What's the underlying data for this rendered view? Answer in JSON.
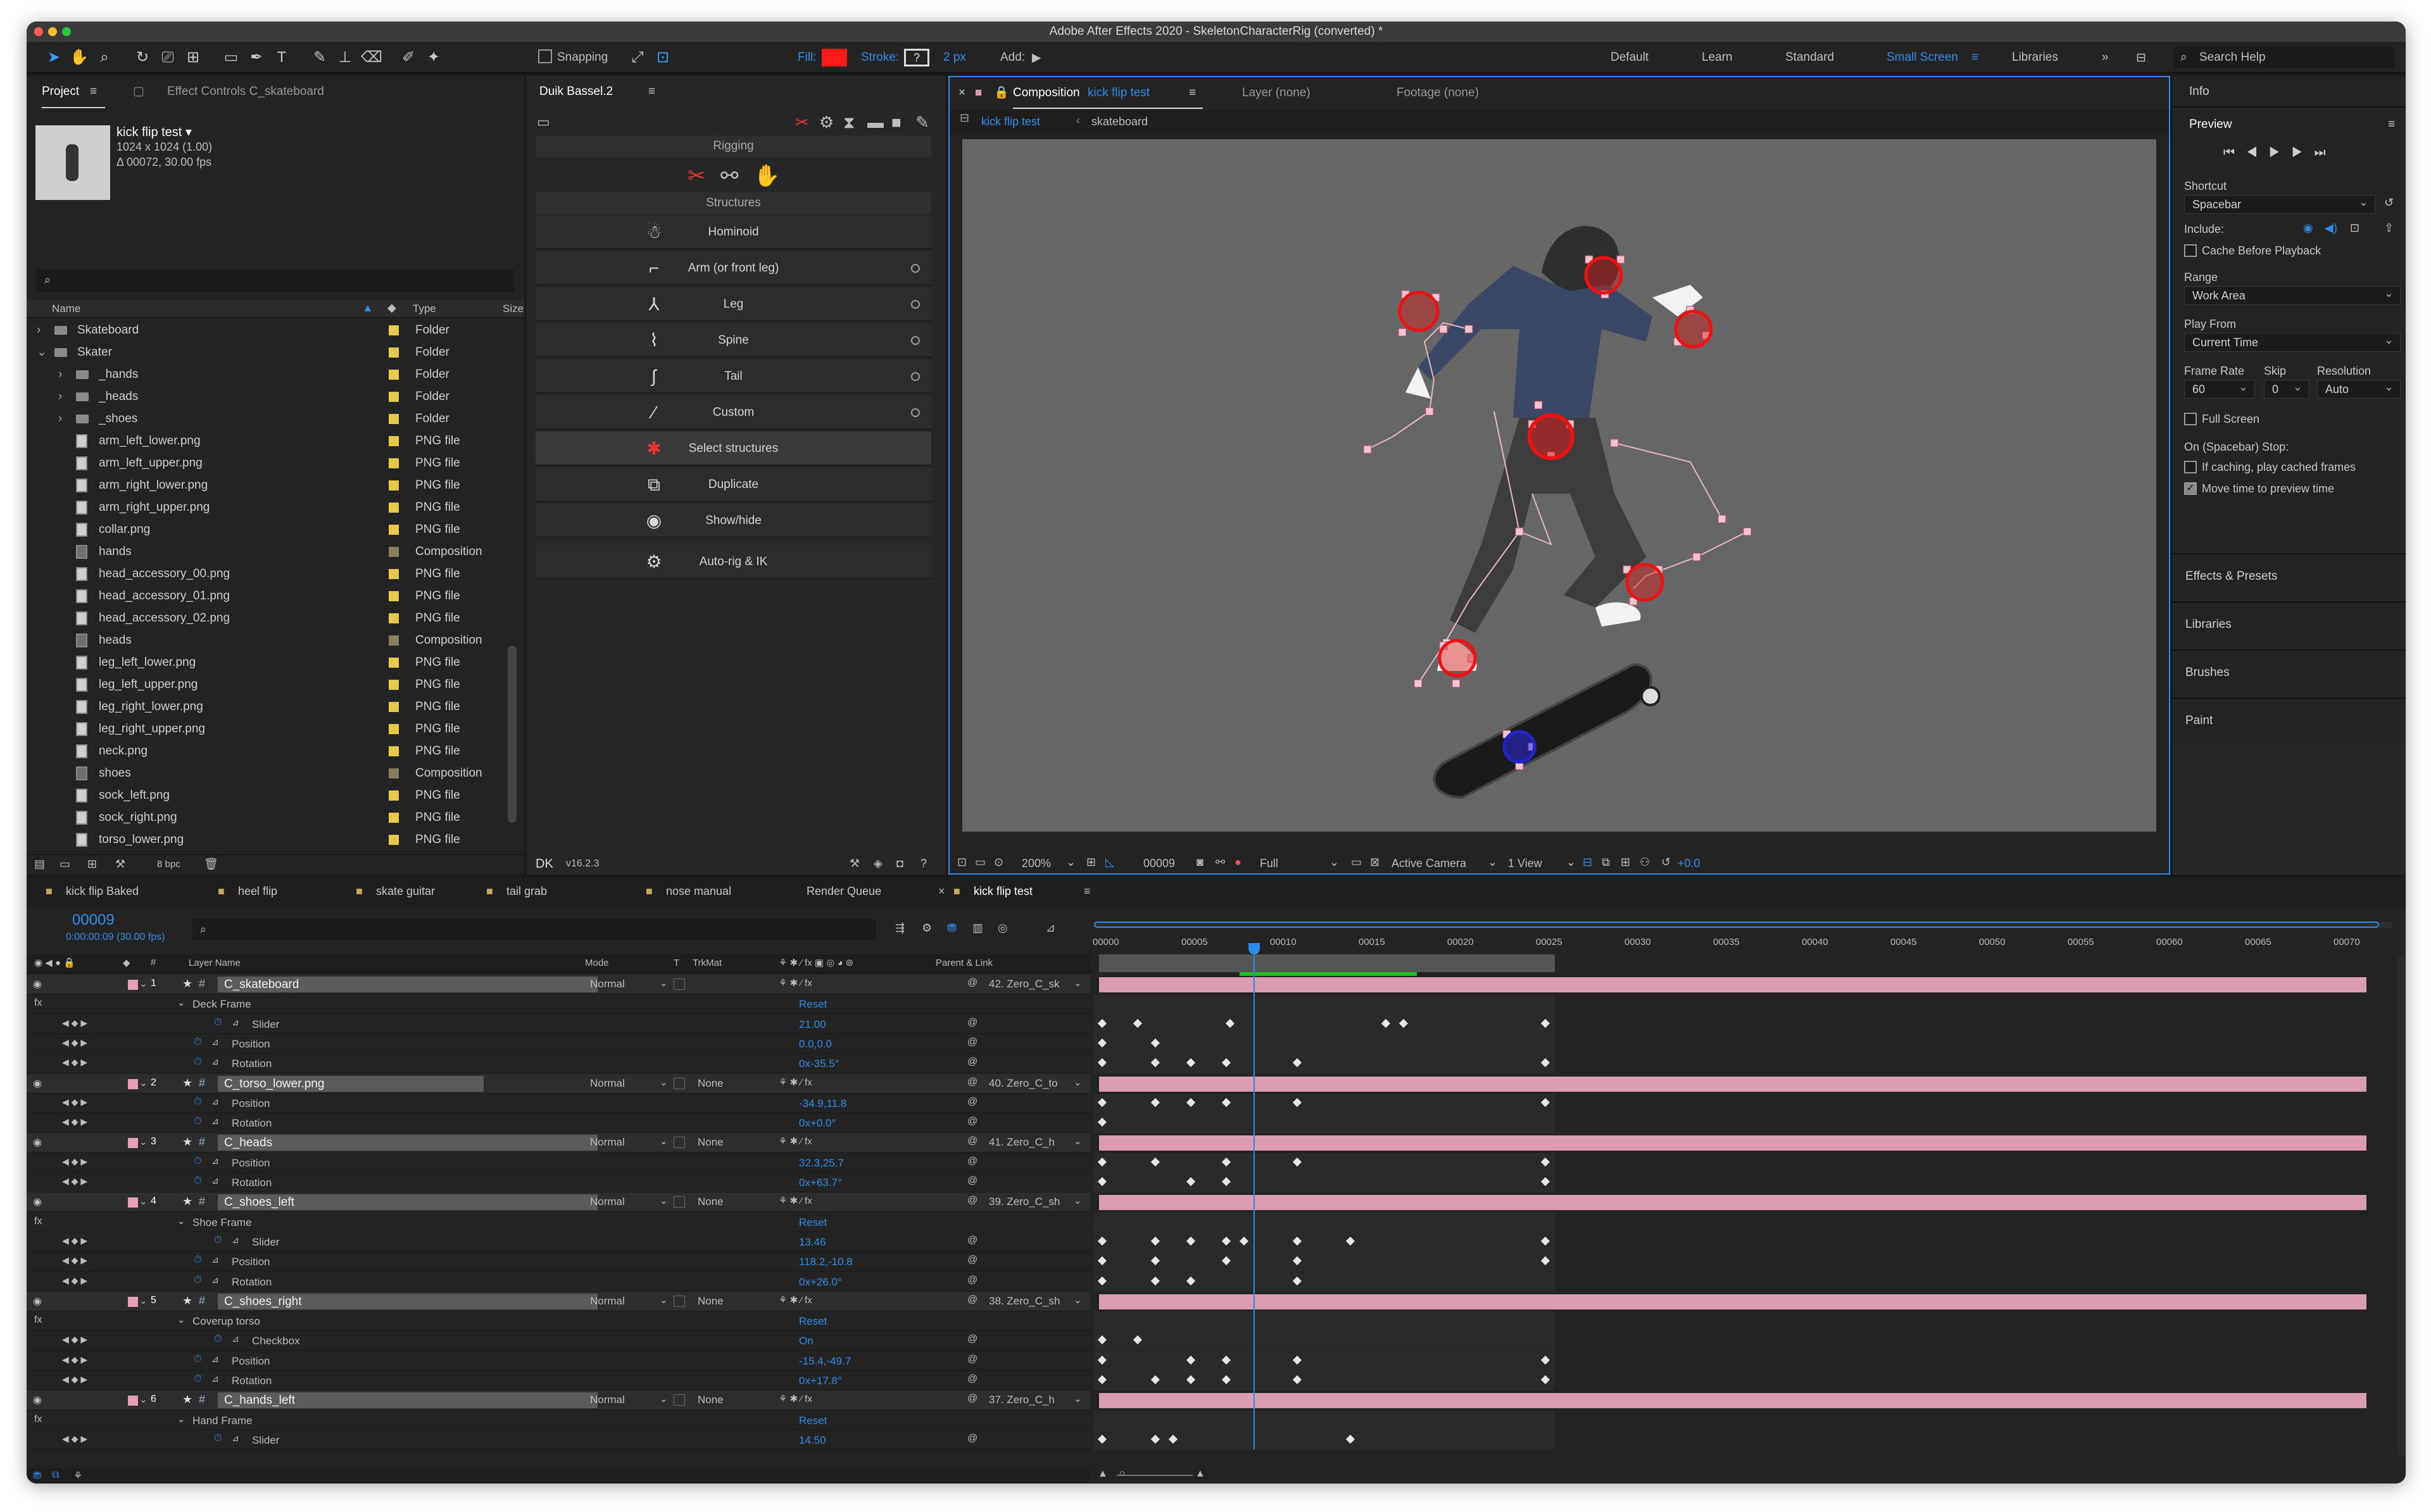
{
  "window": {
    "title": "Adobe After Effects 2020 - SkeletonCharacterRig (converted) *"
  },
  "toolbar": {
    "snapping": "Snapping",
    "fill": "Fill:",
    "stroke": "Stroke:",
    "stroke_width": "2 px",
    "add": "Add:",
    "workspaces": [
      "Default",
      "Learn",
      "Standard",
      "Small Screen",
      "Libraries"
    ],
    "active_workspace": "Small Screen",
    "search_help": "Search Help",
    "fill_color": "#ff1a1a"
  },
  "project": {
    "tab": "Project",
    "effect_tab": "Effect Controls C_skateboard",
    "item_name": "kick flip test ▾",
    "item_size": "1024 x 1024 (1.00)",
    "item_duration": "Δ 00072, 30.00 fps",
    "col_name": "Name",
    "col_type": "Type",
    "col_size": "Size",
    "bpc": "8 bpc",
    "items": [
      {
        "name": "Skateboard",
        "type": "Folder",
        "kind": "folder",
        "indent": 0,
        "twirl": "›"
      },
      {
        "name": "Skater",
        "type": "Folder",
        "kind": "folder",
        "indent": 0,
        "twirl": "⌄"
      },
      {
        "name": "_hands",
        "type": "Folder",
        "kind": "folder",
        "indent": 1,
        "twirl": "›"
      },
      {
        "name": "_heads",
        "type": "Folder",
        "kind": "folder",
        "indent": 1,
        "twirl": "›"
      },
      {
        "name": "_shoes",
        "type": "Folder",
        "kind": "folder",
        "indent": 1,
        "twirl": "›"
      },
      {
        "name": "arm_left_lower.png",
        "type": "PNG file",
        "kind": "file",
        "indent": 1
      },
      {
        "name": "arm_left_upper.png",
        "type": "PNG file",
        "kind": "file",
        "indent": 1
      },
      {
        "name": "arm_right_lower.png",
        "type": "PNG file",
        "kind": "file",
        "indent": 1
      },
      {
        "name": "arm_right_upper.png",
        "type": "PNG file",
        "kind": "file",
        "indent": 1
      },
      {
        "name": "collar.png",
        "type": "PNG file",
        "kind": "file",
        "indent": 1
      },
      {
        "name": "hands",
        "type": "Composition",
        "kind": "comp",
        "indent": 1
      },
      {
        "name": "head_accessory_00.png",
        "type": "PNG file",
        "kind": "file",
        "indent": 1
      },
      {
        "name": "head_accessory_01.png",
        "type": "PNG file",
        "kind": "file",
        "indent": 1
      },
      {
        "name": "head_accessory_02.png",
        "type": "PNG file",
        "kind": "file",
        "indent": 1
      },
      {
        "name": "heads",
        "type": "Composition",
        "kind": "comp",
        "indent": 1
      },
      {
        "name": "leg_left_lower.png",
        "type": "PNG file",
        "kind": "file",
        "indent": 1
      },
      {
        "name": "leg_left_upper.png",
        "type": "PNG file",
        "kind": "file",
        "indent": 1
      },
      {
        "name": "leg_right_lower.png",
        "type": "PNG file",
        "kind": "file",
        "indent": 1
      },
      {
        "name": "leg_right_upper.png",
        "type": "PNG file",
        "kind": "file",
        "indent": 1
      },
      {
        "name": "neck.png",
        "type": "PNG file",
        "kind": "file",
        "indent": 1
      },
      {
        "name": "shoes",
        "type": "Composition",
        "kind": "comp",
        "indent": 1
      },
      {
        "name": "sock_left.png",
        "type": "PNG file",
        "kind": "file",
        "indent": 1
      },
      {
        "name": "sock_right.png",
        "type": "PNG file",
        "kind": "file",
        "indent": 1
      },
      {
        "name": "torso_lower.png",
        "type": "PNG file",
        "kind": "file",
        "indent": 1
      },
      {
        "name": "torso_upper.png",
        "type": "PNG file",
        "kind": "file",
        "indent": 1
      }
    ]
  },
  "duik": {
    "tab": "Duik Bassel.2",
    "rigging": "Rigging",
    "structures": "Structures",
    "version": "v16.2.3",
    "rows": [
      {
        "label": "Hominoid",
        "icon": "☃",
        "dot": false
      },
      {
        "label": "Arm (or front leg)",
        "icon": "⌐",
        "dot": true
      },
      {
        "label": "Leg",
        "icon": "⅄",
        "dot": true
      },
      {
        "label": "Spine",
        "icon": "⌇",
        "dot": true
      },
      {
        "label": "Tail",
        "icon": "∫",
        "dot": true
      },
      {
        "label": "Custom",
        "icon": "⁄",
        "dot": true
      },
      {
        "label": "Select structures",
        "icon": "✱",
        "dot": false
      },
      {
        "label": "Duplicate",
        "icon": "⧉",
        "dot": false
      },
      {
        "label": "Show/hide",
        "icon": "◉",
        "dot": false
      },
      {
        "label": "Auto-rig & IK",
        "icon": "⚙",
        "dot": false
      }
    ]
  },
  "composition": {
    "tab_prefix": "Composition",
    "tab_name": "kick flip test",
    "layer_tab": "Layer (none)",
    "footage_tab": "Footage (none)",
    "crumb_active": "kick flip test",
    "crumb_next": "skateboard",
    "zoom": "200%",
    "frame": "00009",
    "resolution": "Full",
    "camera": "Active Camera",
    "views": "1 View",
    "exposure": "+0.0"
  },
  "right_panel": {
    "info": "Info",
    "preview": "Preview",
    "shortcut_label": "Shortcut",
    "shortcut": "Spacebar",
    "include": "Include:",
    "cache_before": "Cache Before Playback",
    "range_label": "Range",
    "range": "Work Area",
    "play_from_label": "Play From",
    "play_from": "Current Time",
    "frame_rate_label": "Frame Rate",
    "skip_label": "Skip",
    "resolution_label": "Resolution",
    "frame_rate": "60",
    "skip": "0",
    "resolution": "Auto",
    "full_screen": "Full Screen",
    "on_stop": "On (Spacebar) Stop:",
    "if_caching": "If caching, play cached frames",
    "move_time": "Move time to preview time",
    "sections": [
      "Effects & Presets",
      "Libraries",
      "Brushes",
      "Paint"
    ]
  },
  "timeline": {
    "tabs": [
      "kick flip Baked",
      "heel flip",
      "skate guitar",
      "tail grab",
      "nose manual",
      "Render Queue",
      "kick flip test"
    ],
    "active_tab": "kick flip test",
    "timecode": "00009",
    "timecode_sub": "0:00:00:09 (30.00 fps)",
    "col_layer_name": "Layer Name",
    "col_mode": "Mode",
    "col_t": "T",
    "col_trkmat": "TrkMat",
    "col_parent": "Parent & Link",
    "ruler": [
      "00000",
      "00005",
      "00010",
      "00015",
      "00020",
      "00025",
      "00030",
      "00035",
      "00040",
      "00045",
      "00050",
      "00055",
      "00060",
      "00065",
      "00070"
    ],
    "rows": [
      {
        "kind": "layer",
        "num": "1",
        "name": "C_skateboard",
        "mode": "Normal",
        "trkmat": "",
        "parent": "42. Zero_C_sk",
        "kfs": []
      },
      {
        "kind": "fx",
        "label": "Deck Frame",
        "value": "Reset",
        "kfs": []
      },
      {
        "kind": "prop",
        "label": "Slider",
        "value": "21.00",
        "indent": 2,
        "kfs": [
          0,
          1,
          3.6,
          8,
          8.5,
          12.5
        ]
      },
      {
        "kind": "prop",
        "label": "Position",
        "value": "0.0,0.0",
        "indent": 1,
        "kfs": [
          0,
          1.5
        ]
      },
      {
        "kind": "prop",
        "label": "Rotation",
        "value": "0x-35.5°",
        "indent": 1,
        "kfs": [
          0,
          1.5,
          2.5,
          3.5,
          5.5,
          12.5
        ]
      },
      {
        "kind": "layer",
        "num": "2",
        "name": "C_torso_lower.png",
        "mode": "Normal",
        "trkmat": "None",
        "parent": "40. Zero_C_to",
        "kfs": []
      },
      {
        "kind": "prop",
        "label": "Position",
        "value": "-34.9,11.8",
        "indent": 1,
        "kfs": [
          0,
          1.5,
          2.5,
          3.5,
          5.5,
          12.5
        ]
      },
      {
        "kind": "prop",
        "label": "Rotation",
        "value": "0x+0.0°",
        "indent": 1,
        "kfs": [
          0
        ]
      },
      {
        "kind": "layer",
        "num": "3",
        "name": "C_heads",
        "mode": "Normal",
        "trkmat": "None",
        "parent": "41. Zero_C_h",
        "kfs": []
      },
      {
        "kind": "prop",
        "label": "Position",
        "value": "32.3,25.7",
        "indent": 1,
        "kfs": [
          0,
          1.5,
          3.5,
          5.5,
          12.5
        ]
      },
      {
        "kind": "prop",
        "label": "Rotation",
        "value": "0x+63.7°",
        "indent": 1,
        "kfs": [
          0,
          2.5,
          3.5,
          12.5
        ]
      },
      {
        "kind": "layer",
        "num": "4",
        "name": "C_shoes_left",
        "mode": "Normal",
        "trkmat": "None",
        "parent": "39. Zero_C_sh",
        "kfs": []
      },
      {
        "kind": "fx",
        "label": "Shoe Frame",
        "value": "Reset",
        "kfs": []
      },
      {
        "kind": "prop",
        "label": "Slider",
        "value": "13.46",
        "indent": 2,
        "kfs": [
          0,
          1.5,
          2.5,
          3.5,
          4,
          5.5,
          7,
          12.5
        ]
      },
      {
        "kind": "prop",
        "label": "Position",
        "value": "118.2,-10.8",
        "indent": 1,
        "kfs": [
          0,
          1.5,
          3.5,
          5.5,
          12.5
        ]
      },
      {
        "kind": "prop",
        "label": "Rotation",
        "value": "0x+26.0°",
        "indent": 1,
        "kfs": [
          0,
          1.5,
          2.5,
          5.5
        ]
      },
      {
        "kind": "layer",
        "num": "5",
        "name": "C_shoes_right",
        "mode": "Normal",
        "trkmat": "None",
        "parent": "38. Zero_C_sh",
        "kfs": []
      },
      {
        "kind": "fx",
        "label": "Coverup torso",
        "value": "Reset",
        "kfs": []
      },
      {
        "kind": "prop",
        "label": "Checkbox",
        "value": "On",
        "indent": 2,
        "kfs": [
          0,
          1
        ]
      },
      {
        "kind": "prop",
        "label": "Position",
        "value": "-15.4,-49.7",
        "indent": 1,
        "kfs": [
          0,
          2.5,
          3.5,
          5.5,
          12.5
        ]
      },
      {
        "kind": "prop",
        "label": "Rotation",
        "value": "0x+17.8°",
        "indent": 1,
        "kfs": [
          0,
          1.5,
          2.5,
          3.5,
          5.5,
          12.5
        ]
      },
      {
        "kind": "layer",
        "num": "6",
        "name": "C_hands_left",
        "mode": "Normal",
        "trkmat": "None",
        "parent": "37. Zero_C_h",
        "kfs": []
      },
      {
        "kind": "fx",
        "label": "Hand Frame",
        "value": "Reset",
        "kfs": []
      },
      {
        "kind": "prop",
        "label": "Slider",
        "value": "14.50",
        "indent": 2,
        "kfs": [
          0,
          1.5,
          2,
          7
        ]
      }
    ],
    "label_color": "#e79fb6",
    "bar_color": "#d99cb0",
    "playhead_frame": 9,
    "work_area_end_frame": 26
  }
}
